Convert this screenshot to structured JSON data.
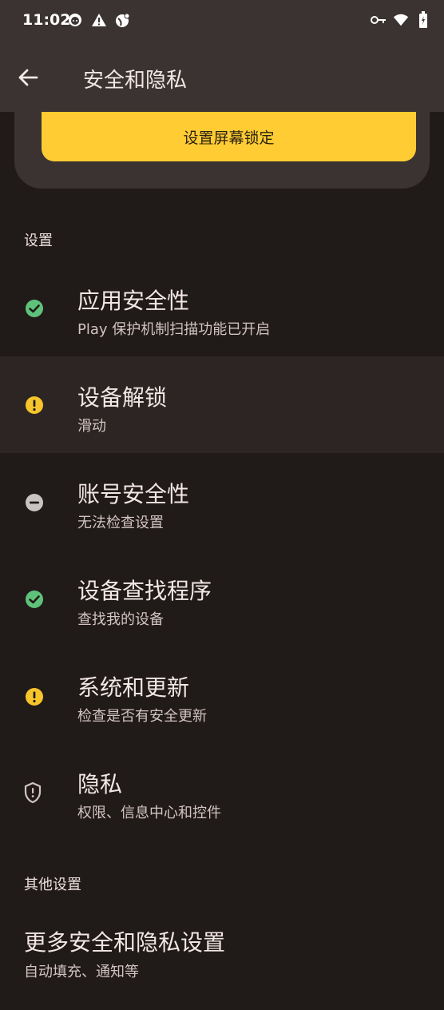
{
  "status_bar": {
    "time": "11:02",
    "left_icons": [
      "android-face-icon",
      "warning-icon",
      "vpn-globe-icon"
    ],
    "right_icons": [
      "key-icon",
      "wifi-icon",
      "battery-icon"
    ]
  },
  "app_bar": {
    "title": "安全和隐私",
    "back_icon": "back-arrow-icon"
  },
  "card": {
    "button_label": "设置屏幕锁定",
    "button_color": "#ffcc33"
  },
  "settings_section": {
    "header": "设置",
    "items": [
      {
        "title": "应用安全性",
        "subtitle": "Play 保护机制扫描功能已开启",
        "status": "ok",
        "icon": "check-circle-icon",
        "color": "#5fc27a"
      },
      {
        "title": "设备解锁",
        "subtitle": "滑动",
        "status": "warning",
        "icon": "exclamation-circle-icon",
        "color": "#f7c52b"
      },
      {
        "title": "账号安全性",
        "subtitle": "无法检查设置",
        "status": "unknown",
        "icon": "minus-circle-icon",
        "color": "#c9c3c1"
      },
      {
        "title": "设备查找程序",
        "subtitle": "查找我的设备",
        "status": "ok",
        "icon": "check-circle-icon",
        "color": "#5fc27a"
      },
      {
        "title": "系统和更新",
        "subtitle": "检查是否有安全更新",
        "status": "warning",
        "icon": "exclamation-circle-icon",
        "color": "#f7c52b"
      },
      {
        "title": "隐私",
        "subtitle": "权限、信息中心和控件",
        "status": "privacy",
        "icon": "shield-icon",
        "color": "#d3c4c1"
      }
    ]
  },
  "other_section": {
    "header": "其他设置",
    "item": {
      "title": "更多安全和隐私设置",
      "subtitle": "自动填充、通知等"
    }
  }
}
